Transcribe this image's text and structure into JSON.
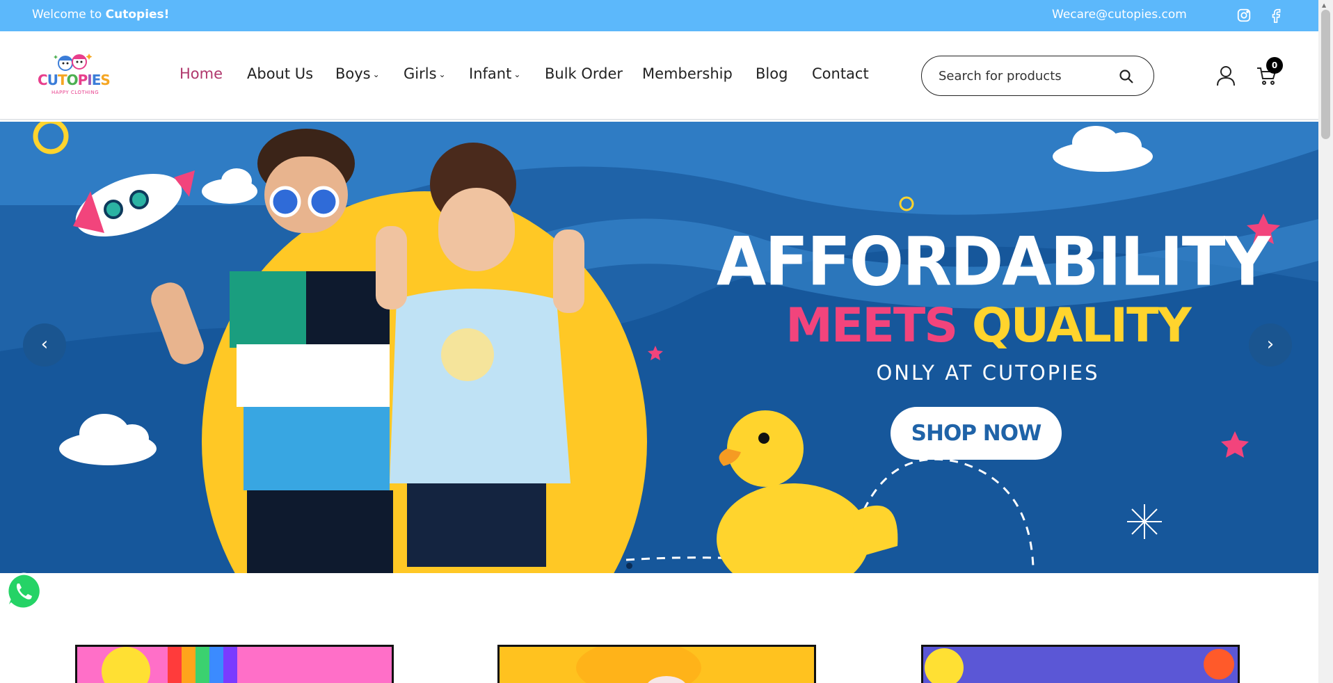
{
  "topbar": {
    "welcome_prefix": "Welcome to ",
    "welcome_brand": "Cutopies!",
    "email": "Wecare@cutopies.com",
    "social_icons": [
      "instagram-icon",
      "facebook-icon"
    ]
  },
  "header": {
    "logo_text": "CUTOPIES",
    "logo_tagline": "HAPPY CLOTHING",
    "nav": [
      {
        "label": "Home",
        "active": true,
        "dropdown": false
      },
      {
        "label": "About Us",
        "active": false,
        "dropdown": false
      },
      {
        "label": "Boys",
        "active": false,
        "dropdown": true
      },
      {
        "label": "Girls",
        "active": false,
        "dropdown": true
      },
      {
        "label": "Infant",
        "active": false,
        "dropdown": true
      },
      {
        "label": "Bulk Order",
        "active": false,
        "dropdown": false
      },
      {
        "label": "Membership",
        "active": false,
        "dropdown": false
      },
      {
        "label": "Blog",
        "active": false,
        "dropdown": false
      },
      {
        "label": "Contact",
        "active": false,
        "dropdown": false
      }
    ],
    "search": {
      "placeholder": "Search for products"
    },
    "cart_count": "0"
  },
  "hero": {
    "line1": "AFFORDABILITY",
    "line2_pink": "MEETS",
    "line2_yellow": "QUALITY",
    "line3": "ONLY AT CUTOPIES",
    "cta": "SHOP NOW",
    "prev_icon": "‹",
    "next_icon": "›",
    "active_slide": 1,
    "slide_count": 1
  },
  "colors": {
    "topbar": "#5cb8fb",
    "nav_active": "#b0376c",
    "hero_bg": "#1f63a8",
    "pink": "#f2447c",
    "yellow": "#ffd42d"
  }
}
